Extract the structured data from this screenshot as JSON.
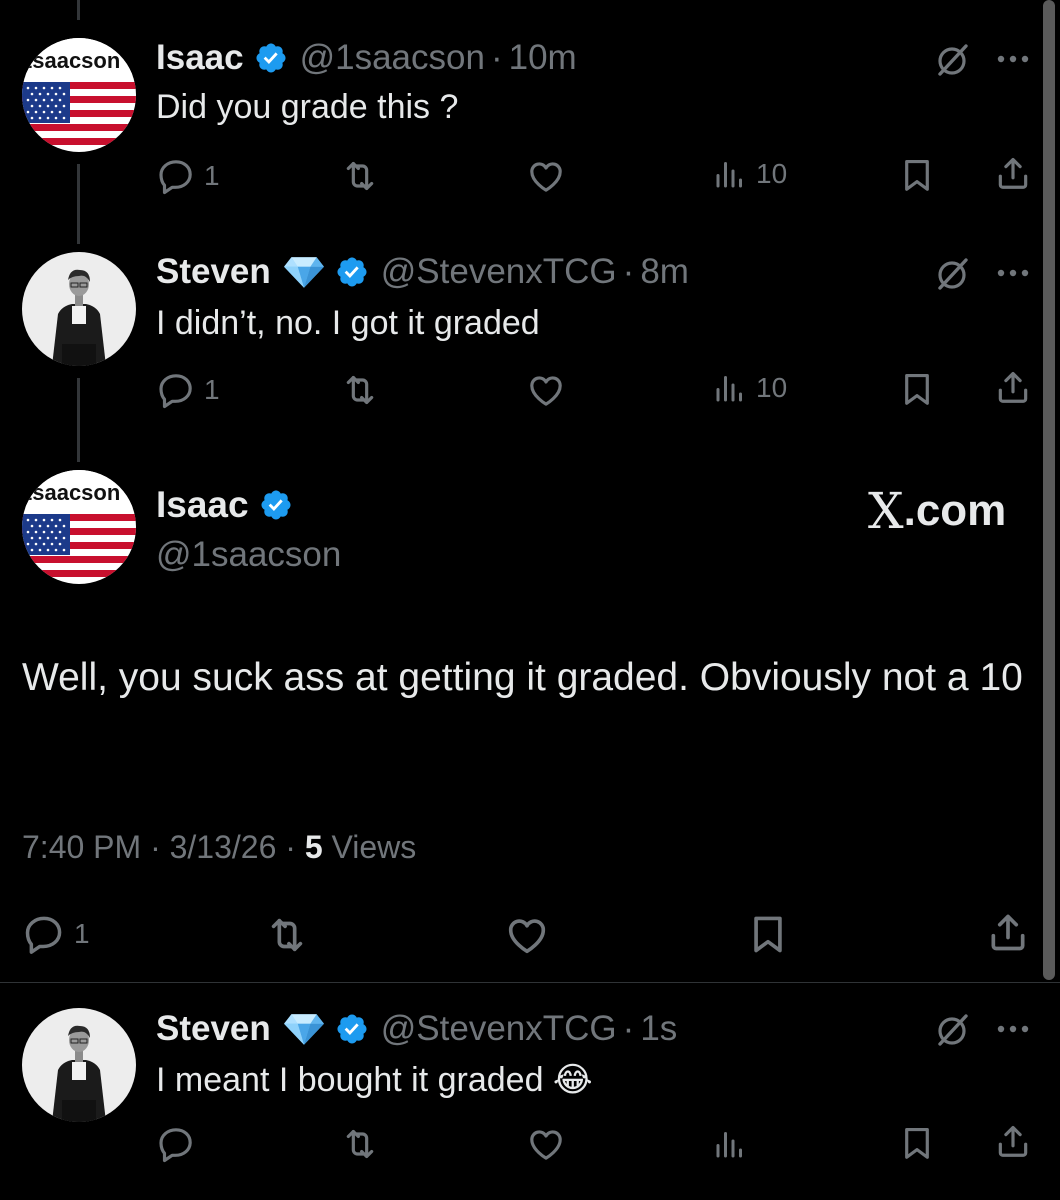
{
  "tweets": [
    {
      "name": "Isaac",
      "handle": "@1saacson",
      "dot": "·",
      "time": "10m",
      "text": "Did you grade this ?",
      "replies": "1",
      "views": "10",
      "avatar_text": "1saacson"
    },
    {
      "name": "Steven",
      "handle": "@StevenxTCG",
      "dot": "·",
      "time": "8m",
      "text": "I didn’t, no. I got it graded",
      "replies": "1",
      "views": "10"
    }
  ],
  "focused": {
    "name": "Isaac",
    "handle": "@1saacson",
    "avatar_text": "1saacson",
    "brand": "X.com",
    "brand_letter": "X",
    "brand_suffix": ".com",
    "text": "Well, you suck ass at getting it graded. Obviously not a 10",
    "time": "7:40 PM",
    "date": "3/13/26",
    "sep": "·",
    "views_count": "5",
    "views_label": "Views",
    "replies": "1"
  },
  "reply": {
    "name": "Steven",
    "handle": "@StevenxTCG",
    "dot": "·",
    "time": "1s",
    "text": "I meant I bought it graded 😂"
  },
  "colors": {
    "background": "#000000",
    "text": "#e7e9ea",
    "muted": "#71767b",
    "verified": "#1d9bf0"
  },
  "icons": [
    "verified-badge-icon",
    "diamond-icon",
    "grok-icon",
    "more-icon",
    "reply-icon",
    "retweet-icon",
    "like-icon",
    "views-icon",
    "bookmark-icon",
    "share-icon",
    "laughing-emoji-icon"
  ]
}
